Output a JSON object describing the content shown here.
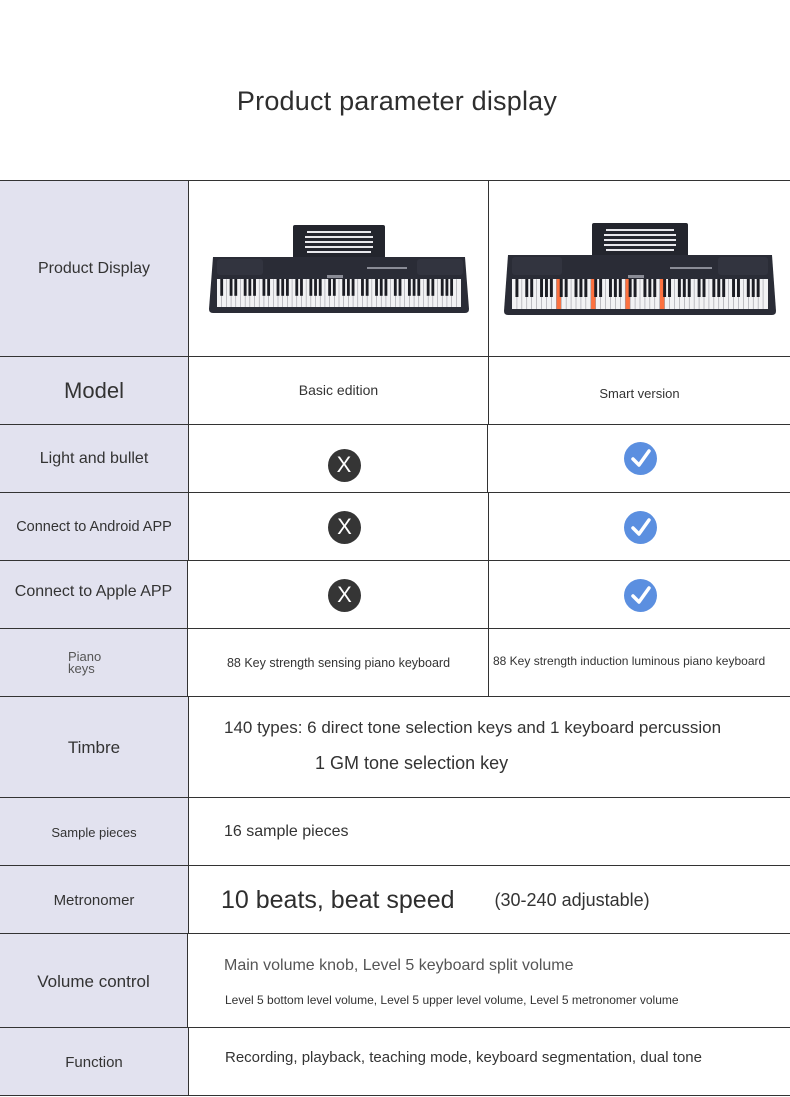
{
  "page": {
    "title": "Product parameter display"
  },
  "colors": {
    "label_background": "#e2e2ef",
    "grid_line": "#333333",
    "no_icon": "#353535",
    "yes_icon": "#5b8fe0",
    "key_light": "#ff5a1e"
  },
  "rows": {
    "product_display": {
      "label": "Product Display",
      "basic_image": "piano-keyboard-image",
      "smart_image": "piano-keyboard-luminous-image"
    },
    "model": {
      "label": "Model",
      "basic": "Basic edition",
      "smart": "Smart version"
    },
    "light_bullet": {
      "label": "Light and bullet",
      "basic_icon": "cross-circle-icon",
      "basic_symbol": "X",
      "smart_icon": "check-circle-icon"
    },
    "android_app": {
      "label": "Connect to Android APP",
      "basic_icon": "cross-circle-icon",
      "basic_symbol": "X",
      "smart_icon": "check-circle-icon"
    },
    "apple_app": {
      "label": "Connect to Apple APP",
      "basic_icon": "cross-circle-icon",
      "basic_symbol": "X",
      "smart_icon": "check-circle-icon"
    },
    "piano_keys": {
      "label_line1": "Piano",
      "label_line2": "keys",
      "basic": "88 Key strength sensing piano keyboard",
      "smart": "88 Key strength induction luminous piano keyboard"
    },
    "timbre": {
      "label": "Timbre",
      "line1": "140 types: 6 direct tone selection keys and 1 keyboard percussion",
      "line2": "1 GM tone selection key"
    },
    "sample_pieces": {
      "label": "Sample pieces",
      "value": "16 sample pieces"
    },
    "metronome": {
      "label": "Metronomer",
      "value_main": "10 beats, beat speed",
      "value_range": "(30-240 adjustable)"
    },
    "volume_control": {
      "label": "Volume control",
      "line1": "Main volume knob, Level 5 keyboard split volume",
      "line2": "Level 5 bottom level volume, Level 5 upper level volume, Level 5 metronomer volume"
    },
    "function": {
      "label": "Function",
      "value": "Recording, playback, teaching mode, keyboard segmentation, dual tone"
    }
  }
}
